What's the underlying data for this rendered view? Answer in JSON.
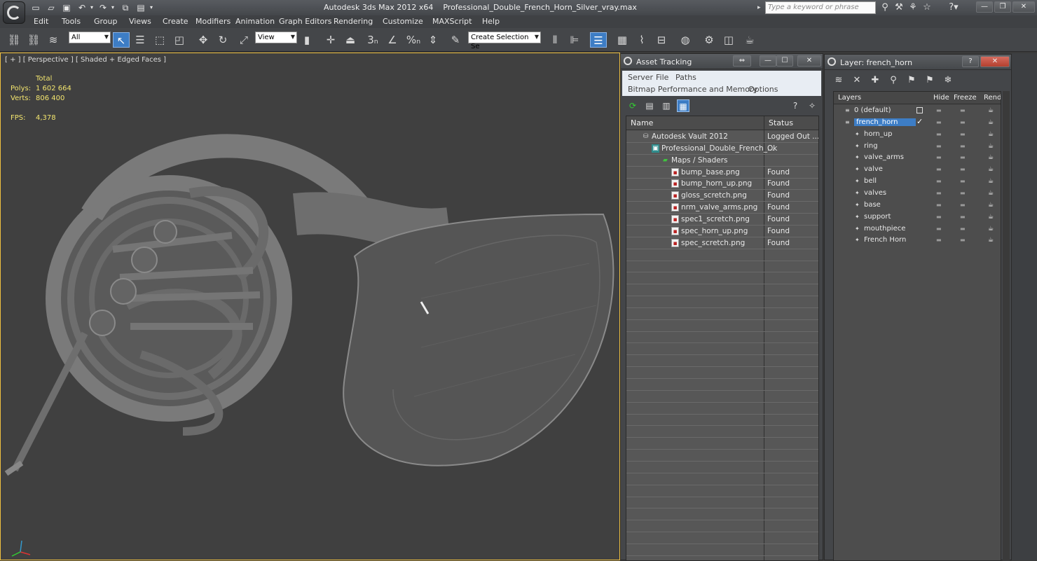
{
  "app": {
    "title": "Autodesk 3ds Max  2012 x64",
    "filename": "Professional_Double_French_Horn_Silver_vray.max",
    "search_placeholder": "Type a keyword or phrase"
  },
  "menu": [
    "Edit",
    "Tools",
    "Group",
    "Views",
    "Create",
    "Modifiers",
    "Animation",
    "Graph Editors",
    "Rendering",
    "Customize",
    "MAXScript",
    "Help"
  ],
  "toolbar": {
    "selection_filter": "All",
    "ref_coord": "View",
    "named_selection": "Create Selection Se",
    "snap_labels": [
      "3",
      "%"
    ]
  },
  "viewport": {
    "label": "[ + ] [ Perspective ] [ Shaded + Edged Faces ]",
    "stats_header": "Total",
    "polys_label": "Polys:",
    "polys_value": "1 602 664",
    "verts_label": "Verts:",
    "verts_value": "806 400",
    "fps_label": "FPS:",
    "fps_value": "4,378"
  },
  "asset_tracking": {
    "title": "Asset Tracking",
    "menus_row1": [
      "Server",
      "File",
      "Paths"
    ],
    "menus_row2": [
      "Bitmap Performance and Memory",
      "Options"
    ],
    "col_name": "Name",
    "col_status": "Status",
    "rows": [
      {
        "name": "Autodesk Vault 2012",
        "status": "Logged Out ...",
        "icon": "vault",
        "indent": 0
      },
      {
        "name": "Professional_Double_French_...",
        "status": "Ok",
        "icon": "max",
        "indent": 1
      },
      {
        "name": "Maps / Shaders",
        "status": "",
        "icon": "map",
        "indent": 2
      },
      {
        "name": "bump_base.png",
        "status": "Found",
        "icon": "file",
        "indent": 3
      },
      {
        "name": "bump_horn_up.png",
        "status": "Found",
        "icon": "file",
        "indent": 3
      },
      {
        "name": "gloss_scretch.png",
        "status": "Found",
        "icon": "file",
        "indent": 3
      },
      {
        "name": "nrm_valve_arms.png",
        "status": "Found",
        "icon": "file",
        "indent": 3
      },
      {
        "name": "spec1_scretch.png",
        "status": "Found",
        "icon": "file",
        "indent": 3
      },
      {
        "name": "spec_horn_up.png",
        "status": "Found",
        "icon": "file",
        "indent": 3
      },
      {
        "name": "spec_scretch.png",
        "status": "Found",
        "icon": "file",
        "indent": 3
      }
    ]
  },
  "layer_panel": {
    "title": "Layer: french_horn",
    "col_layers": "Layers",
    "col_hide": "Hide",
    "col_freeze": "Freeze",
    "col_render": "Rende",
    "rows": [
      {
        "name": "0 (default)",
        "indent": 0,
        "type": "layer"
      },
      {
        "name": "french_horn",
        "indent": 0,
        "type": "layer",
        "selected": true
      },
      {
        "name": "horn_up",
        "indent": 1,
        "type": "object"
      },
      {
        "name": "ring",
        "indent": 1,
        "type": "object"
      },
      {
        "name": "valve_arms",
        "indent": 1,
        "type": "object"
      },
      {
        "name": "valve",
        "indent": 1,
        "type": "object"
      },
      {
        "name": "bell",
        "indent": 1,
        "type": "object"
      },
      {
        "name": "valves",
        "indent": 1,
        "type": "object"
      },
      {
        "name": "base",
        "indent": 1,
        "type": "object"
      },
      {
        "name": "support",
        "indent": 1,
        "type": "object"
      },
      {
        "name": "mouthpiece",
        "indent": 1,
        "type": "object"
      },
      {
        "name": "French Horn",
        "indent": 1,
        "type": "object"
      }
    ]
  },
  "colors": {
    "accent": "#3d7dc5",
    "stats": "#f3e56e",
    "viewport_border": "#f0c040"
  }
}
